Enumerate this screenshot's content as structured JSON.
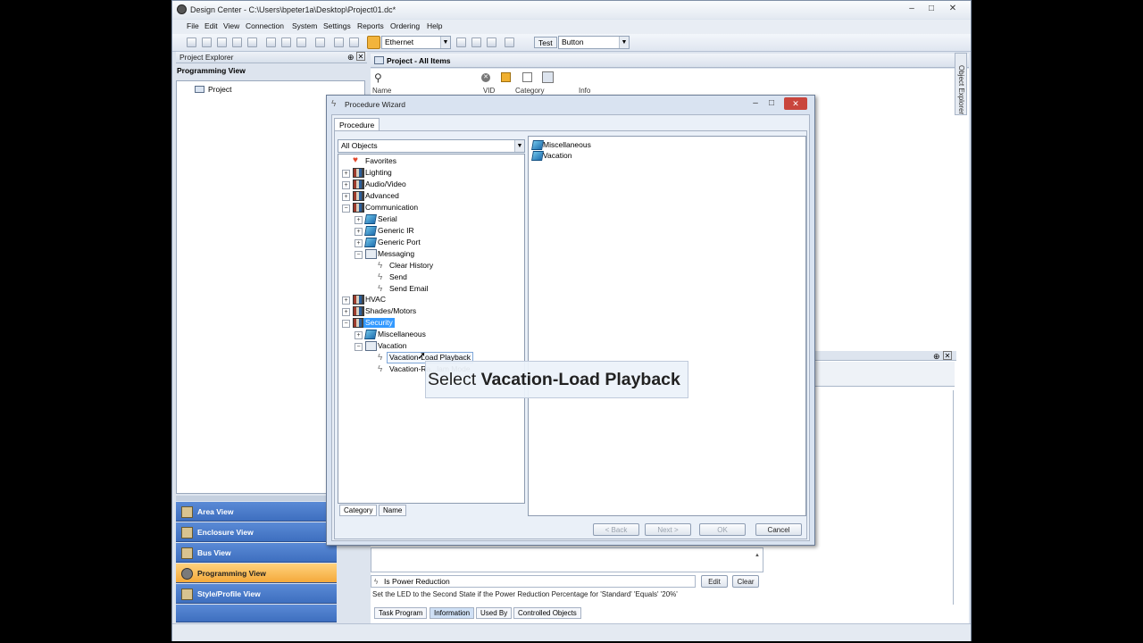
{
  "window": {
    "title": "Design Center - C:\\Users\\bpeter1a\\Desktop\\Project01.dc*",
    "min": "–",
    "max": "□",
    "close": "✕"
  },
  "menu": [
    "File",
    "Edit",
    "View",
    "Connection",
    "System",
    "Settings",
    "Reports",
    "Ordering",
    "Help"
  ],
  "toolbar": {
    "connection": "Ethernet",
    "test_label": "Test",
    "test_value": "Button"
  },
  "explorer": {
    "title": "Project Explorer",
    "view_title": "Programming View",
    "root": "Project"
  },
  "views": [
    "Area View",
    "Enclosure View",
    "Bus View",
    "Programming View",
    "Style/Profile View"
  ],
  "main": {
    "title": "Project - All Items",
    "columns": [
      "Name",
      "VID",
      "Category",
      "Info"
    ]
  },
  "object_explorer": "Object Explorer",
  "dialog": {
    "title": "Procedure Wizard",
    "tab": "Procedure",
    "filter": "All Objects",
    "tree": [
      {
        "label": "Favorites"
      },
      {
        "label": "Lighting"
      },
      {
        "label": "Audio/Video"
      },
      {
        "label": "Advanced"
      },
      {
        "label": "Communication"
      },
      {
        "label": "Serial"
      },
      {
        "label": "Generic IR"
      },
      {
        "label": "Generic Port"
      },
      {
        "label": "Messaging"
      },
      {
        "label": "Clear History"
      },
      {
        "label": "Send"
      },
      {
        "label": "Send Email"
      },
      {
        "label": "HVAC"
      },
      {
        "label": "Shades/Motors"
      },
      {
        "label": "Security"
      },
      {
        "label": "Miscellaneous"
      },
      {
        "label": "Vacation"
      },
      {
        "label": "Vacation-Load Playback"
      },
      {
        "label": "Vacation-Ra...lam Mode"
      }
    ],
    "list": [
      "Miscellaneous",
      "Vacation"
    ],
    "bottom_tabs": [
      "Category",
      "Name"
    ],
    "buttons": {
      "back": "< Back",
      "next": "Next >",
      "ok": "OK",
      "cancel": "Cancel"
    }
  },
  "callout": {
    "prefix": "Select ",
    "emph": "Vacation-Load Playback"
  },
  "lower": {
    "condition": "Is Power Reduction",
    "edit": "Edit",
    "clear": "Clear",
    "description": "Set the LED to the Second State if the Power Reduction Percentage for 'Standard' 'Equals' '20%'",
    "tabs": [
      "Task Program",
      "Information",
      "Used By",
      "Controlled Objects"
    ]
  }
}
